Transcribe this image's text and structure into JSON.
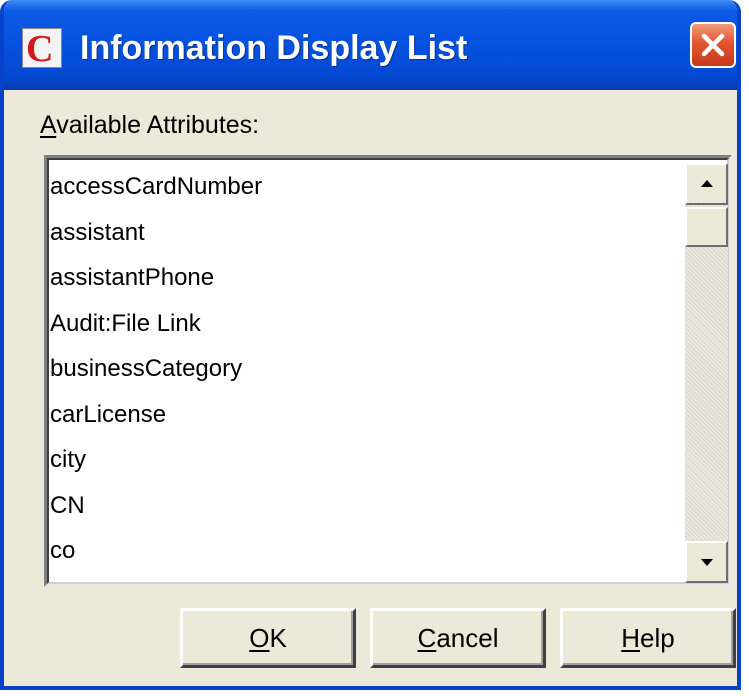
{
  "window": {
    "title": "Information Display List",
    "icon_letter": "C",
    "icon": "app-c-icon",
    "close_icon": "close-x-icon"
  },
  "available_attributes": {
    "label": "Available Attributes:",
    "items": [
      "accessCardNumber",
      "assistant",
      "assistantPhone",
      "Audit:File Link",
      "businessCategory",
      "carLicense",
      "city",
      "CN",
      "co"
    ]
  },
  "buttons": {
    "ok": "OK",
    "cancel": "Cancel",
    "help": "Help"
  },
  "colors": {
    "titlebar": "#0553e0",
    "dialog_bg": "#ece9d8",
    "close_button": "#e2562f",
    "icon_letter": "#d21a1a"
  }
}
